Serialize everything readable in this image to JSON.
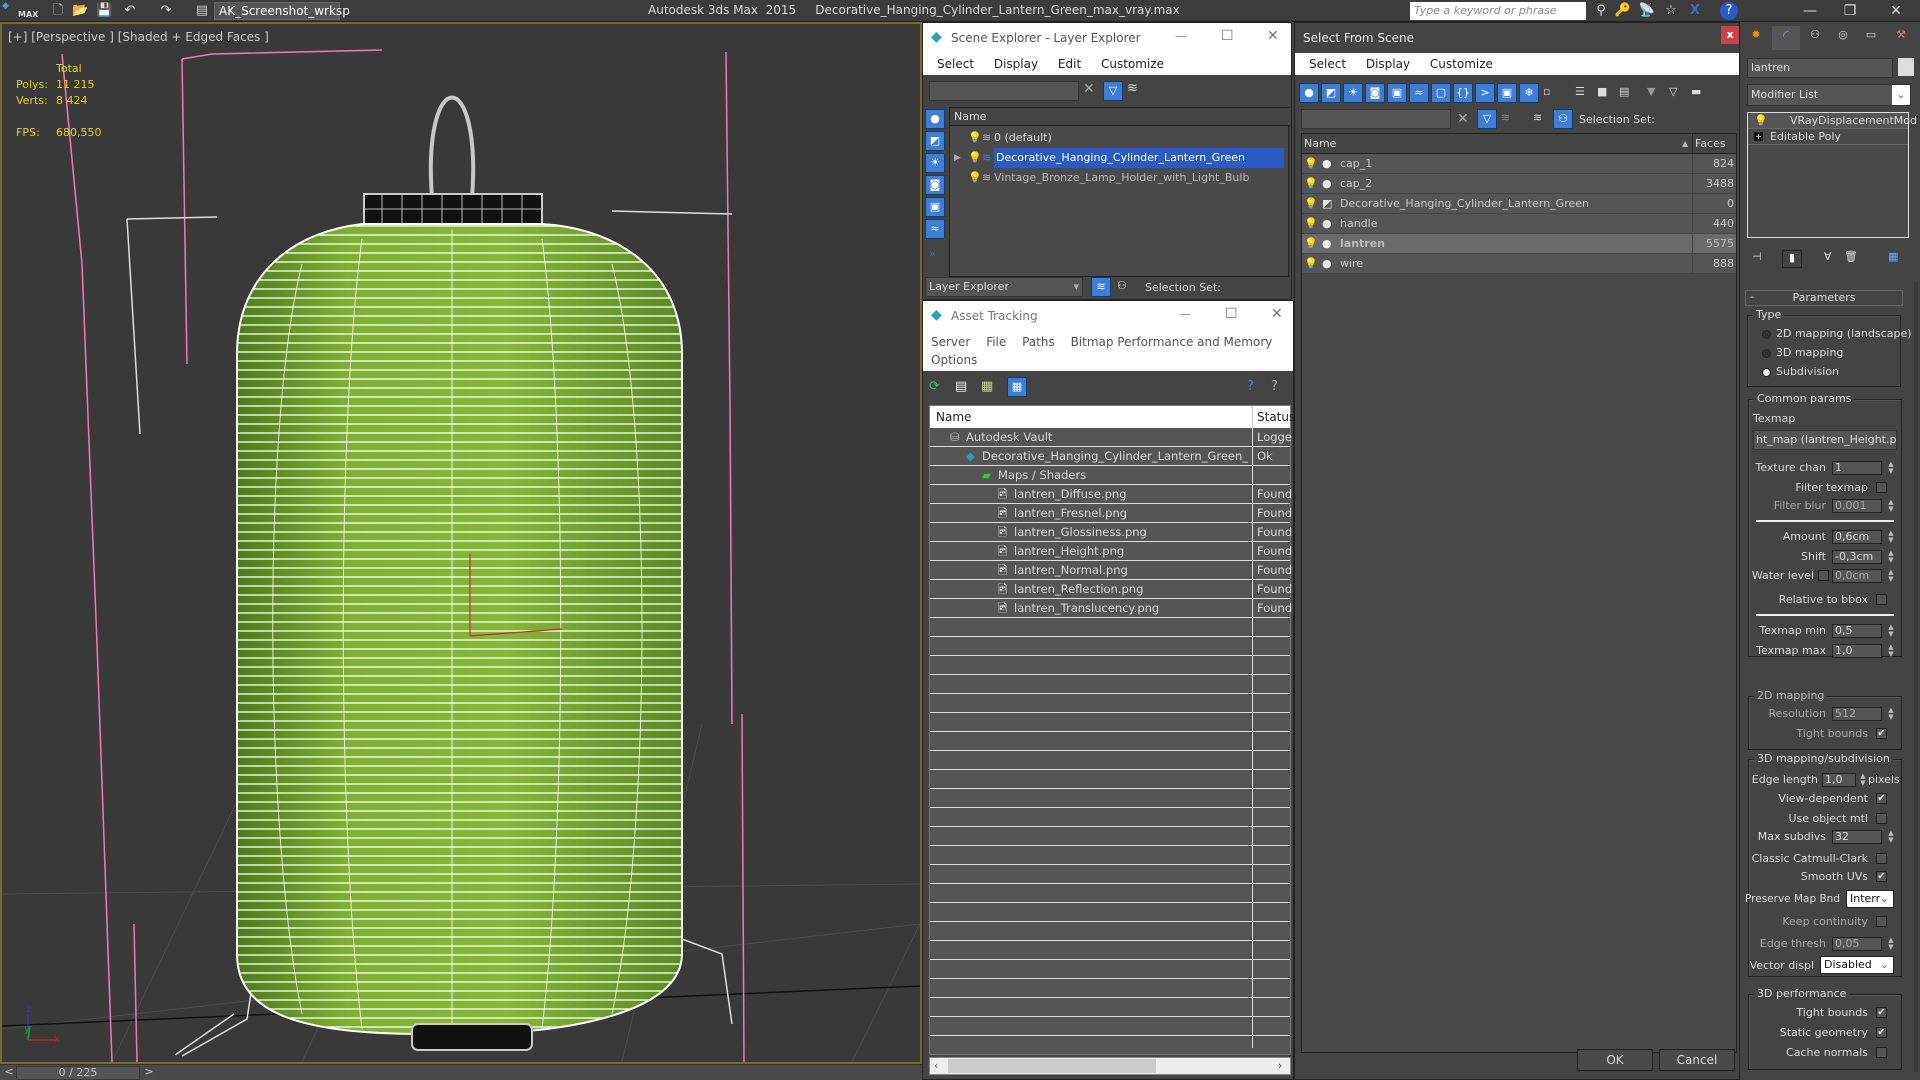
{
  "titlebar": {
    "app_logo": "MAX",
    "workspace": "AK_Screenshot_wrksp",
    "app_name": "Autodesk 3ds Max  2015",
    "file_name": "Decorative_Hanging_Cylinder_Lantern_Green_max_vray.max",
    "search_placeholder": "Type a keyword or phrase",
    "icons": [
      "new-file-icon",
      "open-file-icon",
      "save-icon",
      "undo-icon",
      "redo-icon",
      "project-folder-icon"
    ],
    "right_icons": [
      "binoculars-icon",
      "key-icon",
      "satellite-icon",
      "star-icon",
      "x-icon",
      "help-icon"
    ],
    "window_controls": {
      "minimize": "—",
      "restore": "❐",
      "close": "✕"
    }
  },
  "viewport": {
    "label": "[+] [Perspective ] [Shaded + Edged Faces ]",
    "stats": {
      "total_label": "Total",
      "polys_label": "Polys:",
      "polys_value": "11 215",
      "verts_label": "Verts:",
      "verts_value": "8 424",
      "fps_label": "FPS:",
      "fps_value": "680,550"
    },
    "axis": {
      "z": "z",
      "y": "y",
      "x": "x"
    },
    "timeline": {
      "value": "0 / 225",
      "prev": "<",
      "next": ">"
    }
  },
  "scene_explorer": {
    "title": "Scene Explorer - Layer Explorer",
    "menu": [
      "Select",
      "Display",
      "Edit",
      "Customize"
    ],
    "column_name": "Name",
    "layers": [
      {
        "name": "0 (default)",
        "selected": false,
        "expandable": false
      },
      {
        "name": "Decorative_Hanging_Cylinder_Lantern_Green",
        "selected": true,
        "expandable": true
      },
      {
        "name": "Vintage_Bronze_Lamp_Holder_with_Light_Bulb",
        "selected": false,
        "expandable": false
      }
    ],
    "footer_dropdown": "Layer Explorer",
    "selection_set_label": "Selection Set:"
  },
  "asset_tracking": {
    "title": "Asset Tracking",
    "menu": [
      "Server",
      "File",
      "Paths",
      "Bitmap Performance and Memory",
      "Options"
    ],
    "columns": {
      "name": "Name",
      "status": "Status"
    },
    "rows": [
      {
        "name": "Autodesk Vault",
        "status": "Logged",
        "indent": 0,
        "icon": "vault-icon"
      },
      {
        "name": "Decorative_Hanging_Cylinder_Lantern_Green_...",
        "status": "Ok",
        "indent": 1,
        "icon": "max-file-icon"
      },
      {
        "name": "Maps / Shaders",
        "status": "",
        "indent": 2,
        "icon": "maps-icon"
      },
      {
        "name": "lantren_Diffuse.png",
        "status": "Found",
        "indent": 3,
        "icon": "image-file-icon"
      },
      {
        "name": "lantren_Fresnel.png",
        "status": "Found",
        "indent": 3,
        "icon": "image-file-icon"
      },
      {
        "name": "lantren_Glossiness.png",
        "status": "Found",
        "indent": 3,
        "icon": "image-file-icon"
      },
      {
        "name": "lantren_Height.png",
        "status": "Found",
        "indent": 3,
        "icon": "image-file-icon"
      },
      {
        "name": "lantren_Normal.png",
        "status": "Found",
        "indent": 3,
        "icon": "image-file-icon"
      },
      {
        "name": "lantren_Reflection.png",
        "status": "Found",
        "indent": 3,
        "icon": "image-file-icon"
      },
      {
        "name": "lantren_Translucency.png",
        "status": "Found",
        "indent": 3,
        "icon": "image-file-icon"
      }
    ]
  },
  "select_from_scene": {
    "title": "Select From Scene",
    "close": "x",
    "menu": [
      "Select",
      "Display",
      "Customize"
    ],
    "selection_set_label": "Selection Set:",
    "columns": {
      "name": "Name",
      "faces": "Faces"
    },
    "objects": [
      {
        "name": "cap_1",
        "faces": "824",
        "selected": false
      },
      {
        "name": "cap_2",
        "faces": "3488",
        "selected": false
      },
      {
        "name": "Decorative_Hanging_Cylinder_Lantern_Green",
        "faces": "0",
        "selected": false
      },
      {
        "name": "handle",
        "faces": "440",
        "selected": false
      },
      {
        "name": "lantren",
        "faces": "5575",
        "selected": true
      },
      {
        "name": "wire",
        "faces": "888",
        "selected": false
      }
    ],
    "ok": "OK",
    "cancel": "Cancel"
  },
  "command_panel": {
    "object_name": "lantren",
    "modifier_list": "Modifier List",
    "stack": [
      "VRayDisplacementMod",
      "Editable Poly"
    ],
    "rollout_title": "Parameters",
    "type_group": "Type",
    "type_options": [
      "2D mapping (landscape)",
      "3D mapping",
      "Subdivision"
    ],
    "type_selected": "Subdivision",
    "common_group": "Common params",
    "texmap_label": "Texmap",
    "texmap_value": "ht_map (lantren_Height.png)",
    "texture_chan_label": "Texture chan",
    "texture_chan": "1",
    "filter_texmap_label": "Filter texmap",
    "filter_texmap": false,
    "filter_blur_label": "Filter blur",
    "filter_blur": "0,001",
    "amount_label": "Amount",
    "amount": "0,6cm",
    "shift_label": "Shift",
    "shift": "-0,3cm",
    "water_level_label": "Water level",
    "water_level_enabled": false,
    "water_level": "0,0cm",
    "relative_bbox_label": "Relative to bbox",
    "relative_bbox": false,
    "texmap_min_label": "Texmap min",
    "texmap_min": "0,5",
    "texmap_max_label": "Texmap max",
    "texmap_max": "1,0",
    "mapping2d_group": "2D mapping",
    "resolution_label": "Resolution",
    "resolution": "512",
    "tight_bounds_2d_label": "Tight bounds",
    "tight_bounds_2d": true,
    "mapping3d_group": "3D mapping/subdivision",
    "edge_length_label": "Edge length",
    "edge_length": "1,0",
    "edge_length_unit": "pixels",
    "view_dependent_label": "View-dependent",
    "view_dependent": true,
    "use_object_mtl_label": "Use object mtl",
    "use_object_mtl": false,
    "max_subdivs_label": "Max subdivs",
    "max_subdivs": "32",
    "catmull_label": "Classic Catmull-Clark",
    "catmull": false,
    "smooth_uvs_label": "Smooth UVs",
    "smooth_uvs": true,
    "preserve_map_label": "Preserve Map Bnd",
    "preserve_map": "Interr",
    "keep_continuity_label": "Keep continuity",
    "keep_continuity": false,
    "edge_thresh_label": "Edge thresh",
    "edge_thresh": "0,05",
    "vector_displ_label": "Vector displ",
    "vector_displ": "Disabled",
    "perf_group": "3D performance",
    "tight_bounds_3d_label": "Tight bounds",
    "tight_bounds_3d": true,
    "static_geometry_label": "Static geometry",
    "static_geometry": true,
    "cache_normals_label": "Cache normals",
    "cache_normals": false
  },
  "colors": {
    "viewport_bg": "#393939",
    "lantern_green": "#7fb032",
    "selection_blue": "#2a5ac8",
    "stats_yellow": "#e6d21c",
    "accent_blue": "#3d7ed8"
  }
}
